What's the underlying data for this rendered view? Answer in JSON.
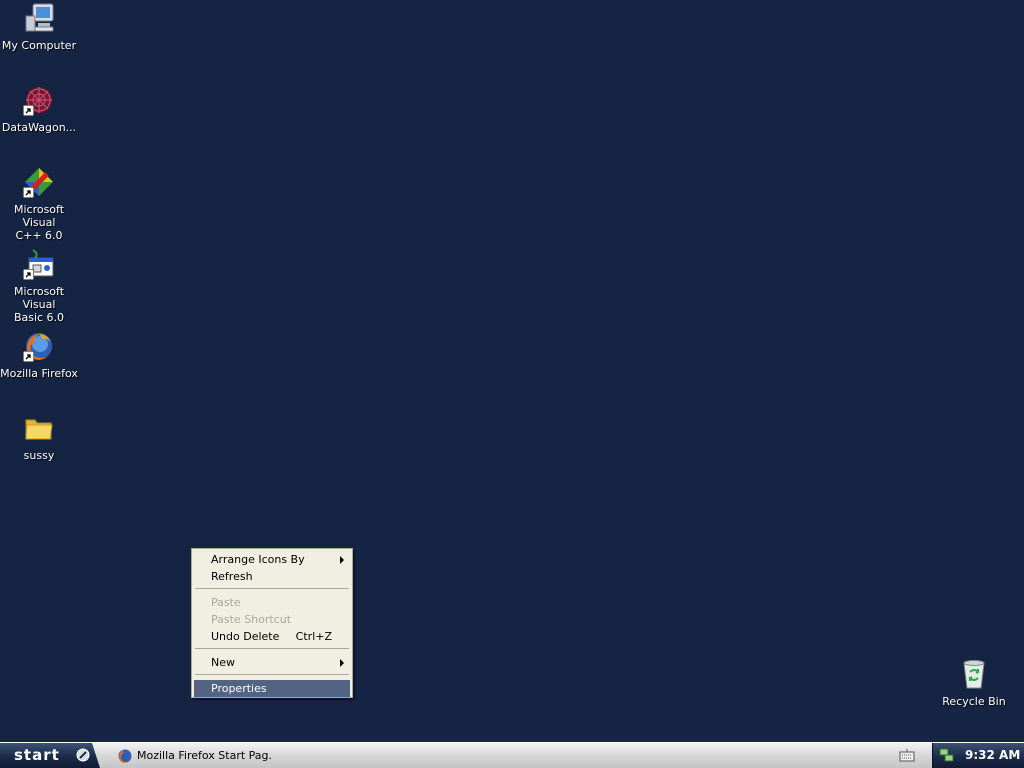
{
  "desktop": {
    "background_color": "#162444",
    "icons": [
      {
        "label_line1": "My Computer",
        "label_line2": "",
        "icon": "computer-icon"
      },
      {
        "label_line1": "DataWagon...",
        "label_line2": "",
        "icon": "datawagon-icon"
      },
      {
        "label_line1": "Microsoft Visual",
        "label_line2": "C++ 6.0",
        "icon": "visual-cpp-icon"
      },
      {
        "label_line1": "Microsoft Visual",
        "label_line2": "Basic 6.0",
        "icon": "visual-basic-icon"
      },
      {
        "label_line1": "Mozilla Firefox",
        "label_line2": "",
        "icon": "firefox-icon"
      },
      {
        "label_line1": "sussy",
        "label_line2": "",
        "icon": "folder-icon"
      }
    ],
    "recycle_bin": {
      "label": "Recycle Bin",
      "icon": "recycle-bin-icon"
    }
  },
  "context_menu": {
    "items": [
      {
        "label": "Arrange Icons By",
        "has_submenu": true,
        "disabled": false
      },
      {
        "label": "Refresh",
        "disabled": false
      },
      {
        "label": "Paste",
        "disabled": true
      },
      {
        "label": "Paste Shortcut",
        "disabled": true
      },
      {
        "label": "Undo Delete",
        "shortcut": "Ctrl+Z",
        "disabled": false
      },
      {
        "label": "New",
        "has_submenu": true,
        "disabled": false
      },
      {
        "label": "Properties",
        "selected": true,
        "disabled": false
      }
    ],
    "highlight_color": "#536482"
  },
  "taskbar": {
    "start_label": "start",
    "task_window_label": "Mozilla Firefox Start Pag...",
    "clock": "9:32 AM",
    "colors": {
      "start": "#1a2a48",
      "tray": "#1a2a48",
      "bar": "#d9d9d9"
    }
  }
}
